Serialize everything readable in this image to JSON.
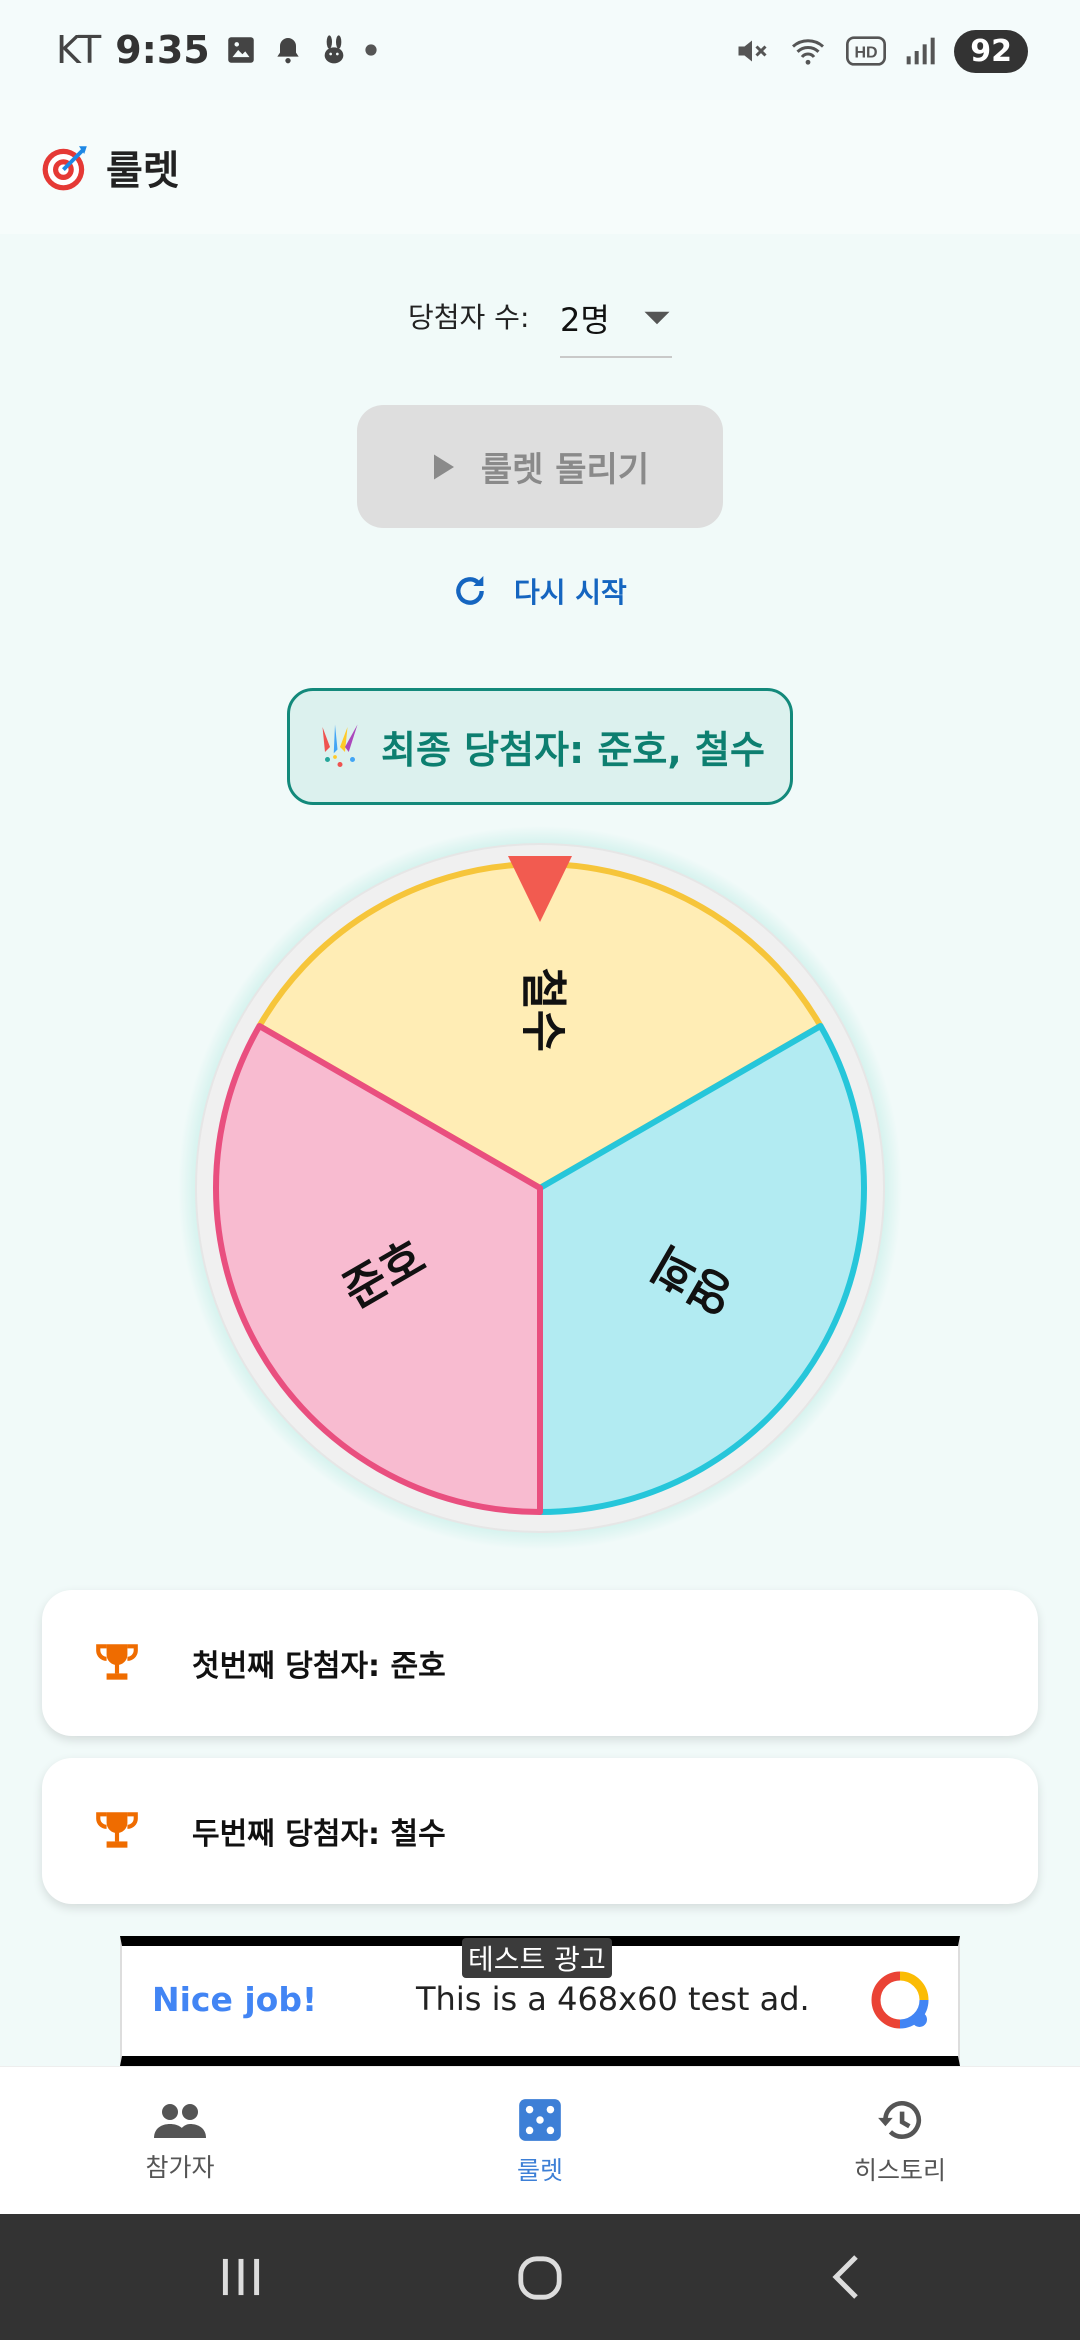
{
  "status_bar": {
    "carrier": "KT",
    "time": "9:35",
    "battery": "92"
  },
  "app_bar": {
    "title": "룰렛",
    "icon": "target-icon"
  },
  "winner_count": {
    "label": "당첨자 수:",
    "value": "2명"
  },
  "spin_button": {
    "label": "룰렛 돌리기",
    "enabled": false
  },
  "restart": {
    "label": "다시 시작"
  },
  "final_winner": {
    "text": "최종 당첨자: 준호, 철수"
  },
  "wheel": {
    "segments": [
      {
        "name": "철수",
        "color": "#ffedb5",
        "border": "#f6c53a"
      },
      {
        "name": "영희",
        "color": "#b2ebf2",
        "border": "#26c6da"
      },
      {
        "name": "준호",
        "color": "#f8bbd0",
        "border": "#e94f7f"
      }
    ],
    "pointer_color": "#f25b50"
  },
  "winners": [
    {
      "text": "첫번째 당첨자: 준호"
    },
    {
      "text": "두번째 당첨자: 철수"
    }
  ],
  "ad": {
    "tag": "테스트 광고",
    "headline": "Nice job!",
    "body": "This is a 468x60 test ad."
  },
  "bottom_nav": [
    {
      "label": "참가자",
      "icon": "people-icon",
      "active": false
    },
    {
      "label": "룰렛",
      "icon": "dice-icon",
      "active": true
    },
    {
      "label": "히스토리",
      "icon": "history-icon",
      "active": false
    }
  ]
}
